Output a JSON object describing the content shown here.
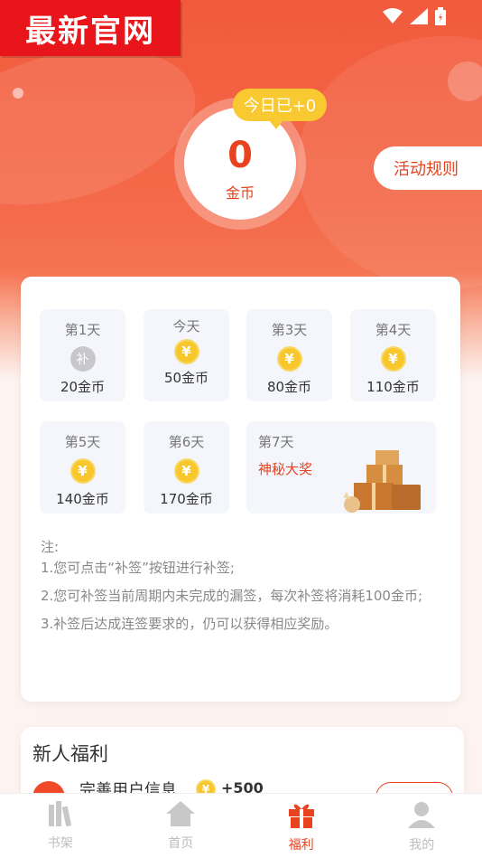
{
  "brand": {
    "badge_text": "最新官网"
  },
  "header": {
    "coin_value": "0",
    "coin_unit": "金币",
    "today_bubble": "今日已+0",
    "rules_button": "活动规则"
  },
  "checkin": {
    "days": [
      {
        "label": "第1天",
        "icon": "bu-icon",
        "icon_text": "补",
        "amount": "20金币"
      },
      {
        "label": "今天",
        "icon": "coin-icon",
        "icon_text": "¥",
        "amount": "50金币"
      },
      {
        "label": "第3天",
        "icon": "coin-icon",
        "icon_text": "¥",
        "amount": "80金币"
      },
      {
        "label": "第4天",
        "icon": "coin-icon",
        "icon_text": "¥",
        "amount": "110金币"
      },
      {
        "label": "第5天",
        "icon": "coin-icon",
        "icon_text": "¥",
        "amount": "140金币"
      },
      {
        "label": "第6天",
        "icon": "coin-icon",
        "icon_text": "¥",
        "amount": "170金币"
      }
    ],
    "day7": {
      "label": "第7天",
      "prize": "神秘大奖",
      "icon": "gift-boxes-icon"
    }
  },
  "notes": {
    "heading": "注:",
    "lines": [
      "1.您可点击“补签”按钮进行补签;",
      "2.您可补签当前周期内未完成的漏签，每次补签将消耗100金币;",
      "3.补签后达成连签要求的，仍可以获得相应奖励。"
    ]
  },
  "newbie": {
    "title": "新人福利",
    "task_label": "完善用户信息",
    "task_reward": "+500"
  },
  "tabbar": {
    "tabs": [
      {
        "label": "书架",
        "icon": "bookshelf-icon",
        "active": false
      },
      {
        "label": "首页",
        "icon": "home-icon",
        "active": false
      },
      {
        "label": "福利",
        "icon": "gift-icon",
        "active": true
      },
      {
        "label": "我的",
        "icon": "user-icon",
        "active": false
      }
    ]
  },
  "colors": {
    "accent": "#e8421f",
    "coin": "#f8c72b",
    "hero": "#f25a3c"
  }
}
